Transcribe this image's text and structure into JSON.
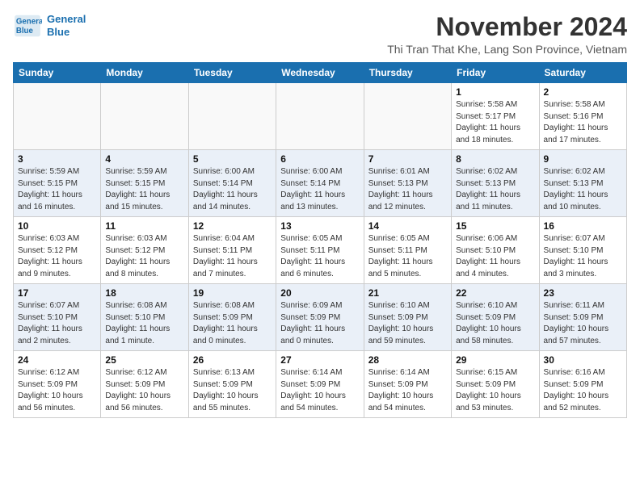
{
  "logo": {
    "line1": "General",
    "line2": "Blue"
  },
  "title": "November 2024",
  "subtitle": "Thi Tran That Khe, Lang Son Province, Vietnam",
  "days_of_week": [
    "Sunday",
    "Monday",
    "Tuesday",
    "Wednesday",
    "Thursday",
    "Friday",
    "Saturday"
  ],
  "weeks": [
    [
      {
        "day": "",
        "detail": ""
      },
      {
        "day": "",
        "detail": ""
      },
      {
        "day": "",
        "detail": ""
      },
      {
        "day": "",
        "detail": ""
      },
      {
        "day": "",
        "detail": ""
      },
      {
        "day": "1",
        "detail": "Sunrise: 5:58 AM\nSunset: 5:17 PM\nDaylight: 11 hours\nand 18 minutes."
      },
      {
        "day": "2",
        "detail": "Sunrise: 5:58 AM\nSunset: 5:16 PM\nDaylight: 11 hours\nand 17 minutes."
      }
    ],
    [
      {
        "day": "3",
        "detail": "Sunrise: 5:59 AM\nSunset: 5:15 PM\nDaylight: 11 hours\nand 16 minutes."
      },
      {
        "day": "4",
        "detail": "Sunrise: 5:59 AM\nSunset: 5:15 PM\nDaylight: 11 hours\nand 15 minutes."
      },
      {
        "day": "5",
        "detail": "Sunrise: 6:00 AM\nSunset: 5:14 PM\nDaylight: 11 hours\nand 14 minutes."
      },
      {
        "day": "6",
        "detail": "Sunrise: 6:00 AM\nSunset: 5:14 PM\nDaylight: 11 hours\nand 13 minutes."
      },
      {
        "day": "7",
        "detail": "Sunrise: 6:01 AM\nSunset: 5:13 PM\nDaylight: 11 hours\nand 12 minutes."
      },
      {
        "day": "8",
        "detail": "Sunrise: 6:02 AM\nSunset: 5:13 PM\nDaylight: 11 hours\nand 11 minutes."
      },
      {
        "day": "9",
        "detail": "Sunrise: 6:02 AM\nSunset: 5:13 PM\nDaylight: 11 hours\nand 10 minutes."
      }
    ],
    [
      {
        "day": "10",
        "detail": "Sunrise: 6:03 AM\nSunset: 5:12 PM\nDaylight: 11 hours\nand 9 minutes."
      },
      {
        "day": "11",
        "detail": "Sunrise: 6:03 AM\nSunset: 5:12 PM\nDaylight: 11 hours\nand 8 minutes."
      },
      {
        "day": "12",
        "detail": "Sunrise: 6:04 AM\nSunset: 5:11 PM\nDaylight: 11 hours\nand 7 minutes."
      },
      {
        "day": "13",
        "detail": "Sunrise: 6:05 AM\nSunset: 5:11 PM\nDaylight: 11 hours\nand 6 minutes."
      },
      {
        "day": "14",
        "detail": "Sunrise: 6:05 AM\nSunset: 5:11 PM\nDaylight: 11 hours\nand 5 minutes."
      },
      {
        "day": "15",
        "detail": "Sunrise: 6:06 AM\nSunset: 5:10 PM\nDaylight: 11 hours\nand 4 minutes."
      },
      {
        "day": "16",
        "detail": "Sunrise: 6:07 AM\nSunset: 5:10 PM\nDaylight: 11 hours\nand 3 minutes."
      }
    ],
    [
      {
        "day": "17",
        "detail": "Sunrise: 6:07 AM\nSunset: 5:10 PM\nDaylight: 11 hours\nand 2 minutes."
      },
      {
        "day": "18",
        "detail": "Sunrise: 6:08 AM\nSunset: 5:10 PM\nDaylight: 11 hours\nand 1 minute."
      },
      {
        "day": "19",
        "detail": "Sunrise: 6:08 AM\nSunset: 5:09 PM\nDaylight: 11 hours\nand 0 minutes."
      },
      {
        "day": "20",
        "detail": "Sunrise: 6:09 AM\nSunset: 5:09 PM\nDaylight: 11 hours\nand 0 minutes."
      },
      {
        "day": "21",
        "detail": "Sunrise: 6:10 AM\nSunset: 5:09 PM\nDaylight: 10 hours\nand 59 minutes."
      },
      {
        "day": "22",
        "detail": "Sunrise: 6:10 AM\nSunset: 5:09 PM\nDaylight: 10 hours\nand 58 minutes."
      },
      {
        "day": "23",
        "detail": "Sunrise: 6:11 AM\nSunset: 5:09 PM\nDaylight: 10 hours\nand 57 minutes."
      }
    ],
    [
      {
        "day": "24",
        "detail": "Sunrise: 6:12 AM\nSunset: 5:09 PM\nDaylight: 10 hours\nand 56 minutes."
      },
      {
        "day": "25",
        "detail": "Sunrise: 6:12 AM\nSunset: 5:09 PM\nDaylight: 10 hours\nand 56 minutes."
      },
      {
        "day": "26",
        "detail": "Sunrise: 6:13 AM\nSunset: 5:09 PM\nDaylight: 10 hours\nand 55 minutes."
      },
      {
        "day": "27",
        "detail": "Sunrise: 6:14 AM\nSunset: 5:09 PM\nDaylight: 10 hours\nand 54 minutes."
      },
      {
        "day": "28",
        "detail": "Sunrise: 6:14 AM\nSunset: 5:09 PM\nDaylight: 10 hours\nand 54 minutes."
      },
      {
        "day": "29",
        "detail": "Sunrise: 6:15 AM\nSunset: 5:09 PM\nDaylight: 10 hours\nand 53 minutes."
      },
      {
        "day": "30",
        "detail": "Sunrise: 6:16 AM\nSunset: 5:09 PM\nDaylight: 10 hours\nand 52 minutes."
      }
    ]
  ]
}
